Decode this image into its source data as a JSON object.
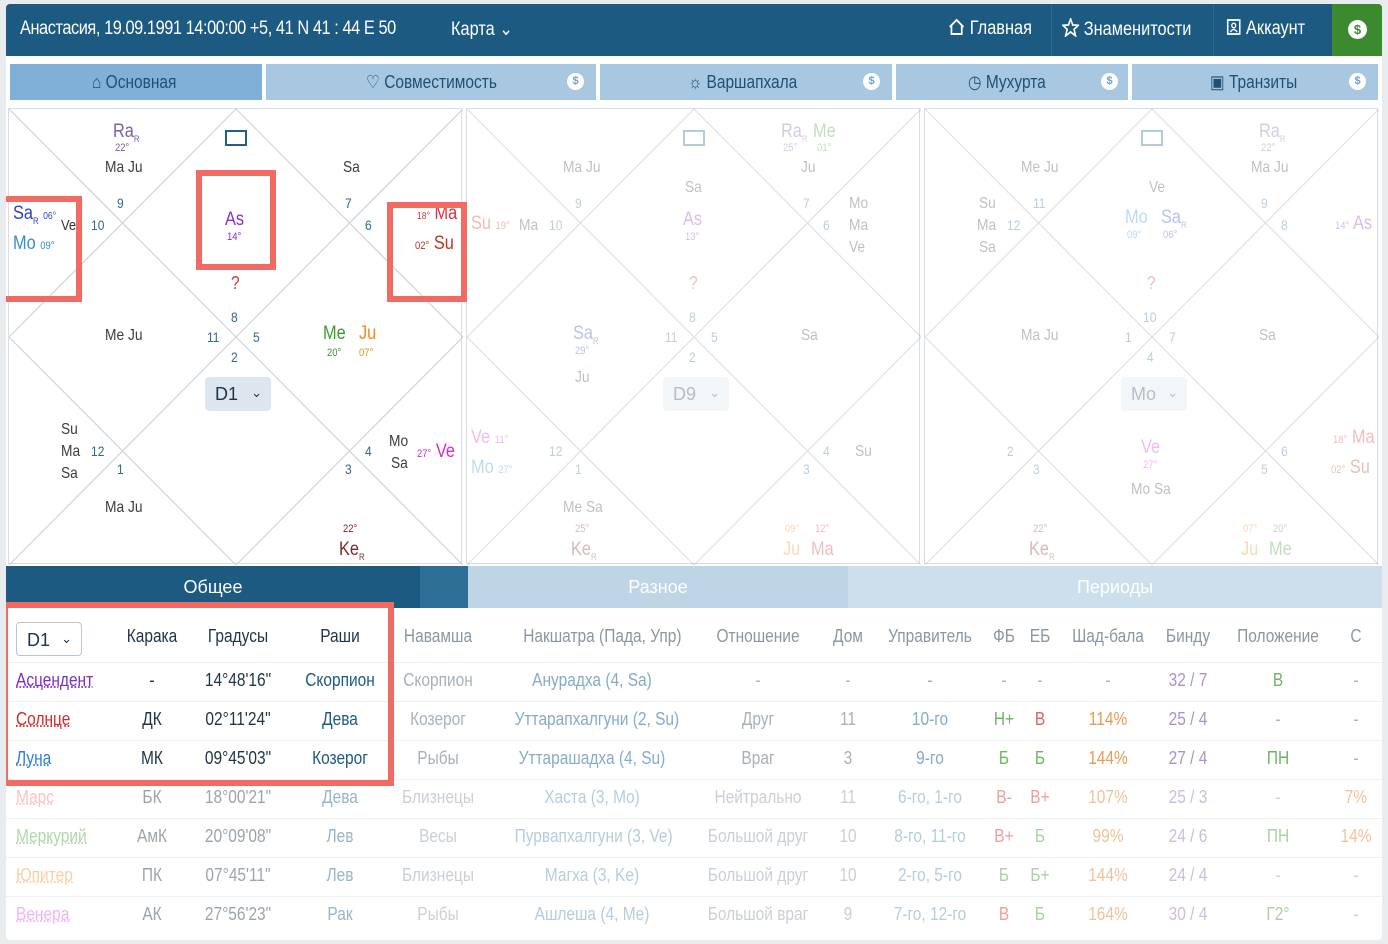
{
  "header": {
    "title": "Анастасия, 19.09.1991 14:00:00 +5, 41 N 41 : 44 E 50",
    "map_menu": "Карта",
    "nav": [
      {
        "label": "Главная",
        "icon": "home-icon"
      },
      {
        "label": "Знаменитости",
        "icon": "star-icon"
      },
      {
        "label": "Аккаунт",
        "icon": "account-icon"
      }
    ],
    "dollar": "$"
  },
  "tabs": [
    {
      "label": "Основная",
      "icon": "home-icon",
      "active": true
    },
    {
      "label": "Совместимость",
      "icon": "heart-icon",
      "paid": true
    },
    {
      "label": "Варшапхала",
      "icon": "sun-icon",
      "paid": true
    },
    {
      "label": "Мухурта",
      "icon": "clock-icon",
      "paid": true
    },
    {
      "label": "Транзиты",
      "icon": "calendar-icon",
      "paid": true
    }
  ],
  "coin": "$",
  "charts": {
    "main": {
      "select": "D1",
      "houses": [
        "9",
        "10",
        "7",
        "6",
        "8",
        "11",
        "5",
        "2",
        "4",
        "3",
        "12",
        "1",
        "?"
      ],
      "planets": {
        "ra": "Ra",
        "ra_r": "R",
        "ra_deg": "22°",
        "top_left": "Ma Ju",
        "sa": "Sa",
        "sa_r": "R",
        "sa_deg": "06°",
        "mo": "Mo",
        "mo_deg": "09°",
        "ve_short": "Ve",
        "as": "As",
        "as_deg": "14°",
        "top_right": "Sa",
        "ma_deg": "18°",
        "ma": "Ma",
        "su_deg": "02°",
        "su": "Su",
        "mid_left": "Me Ju",
        "me": "Me",
        "ju": "Ju",
        "me_deg": "20°",
        "ju_deg": "07°",
        "su2": "Su",
        "ma2": "Ma",
        "sa2": "Sa",
        "bottom_left": "Ma Ju",
        "mo2": "Mo",
        "sa3": "Sa",
        "ve_deg": "27°",
        "ve": "Ve",
        "ke_deg": "22°",
        "ke": "Ke",
        "ke_r": "R"
      }
    },
    "d9": {
      "select": "D9",
      "ra": "Ra",
      "ra_r": "R",
      "me": "Me",
      "ra_deg": "25°",
      "me_deg": "01°",
      "top_left": "Ma Ju",
      "ju": "Ju",
      "sa_top": "Sa",
      "su_deg": "19°",
      "su": "Su",
      "ma": "Ma",
      "as": "As",
      "as_deg": "13°",
      "right_list": [
        "Mo",
        "Ma",
        "Ve"
      ],
      "houses": [
        "9",
        "10",
        "7",
        "6",
        "8",
        "11",
        "5",
        "2",
        "4",
        "3",
        "12",
        "1",
        "?"
      ],
      "sa": "Sa",
      "sa_r": "R",
      "sa_deg": "29°",
      "ju2": "Ju",
      "sa_right": "Sa",
      "ve": "Ve",
      "ve_deg": "11°",
      "mo": "Mo",
      "mo_deg": "27°",
      "su2": "Su",
      "me_sa": "Me Sa",
      "ke_deg": "25°",
      "ke": "Ke",
      "ke_r": "R",
      "ju_deg": "09°",
      "ma_deg": "12°",
      "ju3": "Ju",
      "ma3": "Ma"
    },
    "mo": {
      "select": "Mo",
      "ra": "Ra",
      "ra_r": "R",
      "ra_deg": "22°",
      "ma_ju_top": "Ma Ju",
      "me_ju_top": "Me Ju",
      "ve_top": "Ve",
      "left_list": [
        "Su",
        "Ma",
        "Sa"
      ],
      "mo": "Mo",
      "mo_deg": "09°",
      "sa": "Sa",
      "sa_r": "R",
      "sa_deg": "06°",
      "as_deg": "14°",
      "as": "As",
      "houses": [
        "11",
        "12",
        "9",
        "8",
        "10",
        "1",
        "7",
        "4",
        "2",
        "3",
        "6",
        "5",
        "?"
      ],
      "ma_ju_mid": "Ma Ju",
      "sa_mid": "Sa",
      "ve": "Ve",
      "ve_deg": "27°",
      "mo_sa": "Mo Sa",
      "ma_deg": "18°",
      "ma": "Ma",
      "su_deg": "02°",
      "su": "Su",
      "ke_deg": "22°",
      "ke": "Ke",
      "ke_r": "R",
      "ju_deg": "07°",
      "me_deg": "20°",
      "ju": "Ju",
      "me": "Me"
    }
  },
  "bottom_tabs": [
    "Общее",
    "Разное",
    "Периоды"
  ],
  "table": {
    "select": "D1",
    "headers": [
      "Карака",
      "Градусы",
      "Раши",
      "Навамша",
      "Накшатра (Пада, Упр)",
      "Отношение",
      "Дом",
      "Управитель",
      "ФБ",
      "ЕБ",
      "Шад-бала",
      "Бинду",
      "Положение",
      "С"
    ],
    "rows": [
      {
        "name": "Асцендент",
        "color": "#7b2fc7",
        "karaka": "-",
        "deg": "14°48'16\"",
        "rashi": "Скорпион",
        "nav": "Скорпион",
        "nak": "Анурадха (4, Sa)",
        "rel": "-",
        "dom": "-",
        "upr": "-",
        "fb": "-",
        "eb": "-",
        "shad": "-",
        "bindu": "32 / 7",
        "pos": "В",
        "s": "-"
      },
      {
        "name": "Солнце",
        "color": "#d42a2a",
        "karaka": "ДК",
        "deg": "02°11'24\"",
        "rashi": "Дева",
        "nav": "Козерог",
        "nak": "Уттарапхалгуни (2, Su)",
        "rel": "Друг",
        "dom": "11",
        "upr": "10-го",
        "fb": "Н+",
        "eb": "В",
        "shad": "114%",
        "bindu": "25 / 4",
        "pos": "-",
        "s": "-"
      },
      {
        "name": "Луна",
        "color": "#2f7fd6",
        "karaka": "МК",
        "deg": "09°45'03\"",
        "rashi": "Козерог",
        "nav": "Рыбы",
        "nak": "Уттарашадха (4, Su)",
        "rel": "Враг",
        "dom": "3",
        "upr": "9-го",
        "fb": "Б",
        "eb": "Б",
        "shad": "144%",
        "bindu": "27 / 4",
        "pos": "ПН",
        "s": "-"
      },
      {
        "name": "Марс",
        "color": "#f06a6a",
        "karaka": "БК",
        "deg": "18°00'21\"",
        "rashi": "Дева",
        "nav": "Близнецы",
        "nak": "Хаста (3, Mo)",
        "rel": "Нейтрально",
        "dom": "11",
        "upr": "6-го, 1-го",
        "fb": "В-",
        "eb": "В+",
        "shad": "107%",
        "bindu": "25 / 3",
        "pos": "-",
        "s": "7%"
      },
      {
        "name": "Меркурий",
        "color": "#3c9a2e",
        "karaka": "АмК",
        "deg": "20°09'08\"",
        "rashi": "Лев",
        "nav": "Весы",
        "nak": "Пурвапхалгуни (3, Ve)",
        "rel": "Большой друг",
        "dom": "10",
        "upr": "8-го, 11-го",
        "fb": "В+",
        "eb": "Б",
        "shad": "99%",
        "bindu": "24 / 6",
        "pos": "ПН",
        "s": "14%"
      },
      {
        "name": "Юпитер",
        "color": "#f08a1e",
        "karaka": "ПК",
        "deg": "07°45'11\"",
        "rashi": "Лев",
        "nav": "Близнецы",
        "nak": "Магха (3, Ke)",
        "rel": "Большой друг",
        "dom": "10",
        "upr": "2-го, 5-го",
        "fb": "Б",
        "eb": "Б+",
        "shad": "144%",
        "bindu": "24 / 4",
        "pos": "-",
        "s": "-"
      },
      {
        "name": "Венера",
        "color": "#e040e0",
        "karaka": "АК",
        "deg": "27°56'23\"",
        "rashi": "Рак",
        "nav": "Рыбы",
        "nak": "Ашлеша (4, Me)",
        "rel": "Большой враг",
        "dom": "9",
        "upr": "7-го, 12-го",
        "fb": "В",
        "eb": "Б",
        "shad": "164%",
        "bindu": "30 / 4",
        "pos": "Г2°",
        "s": "-"
      }
    ]
  }
}
